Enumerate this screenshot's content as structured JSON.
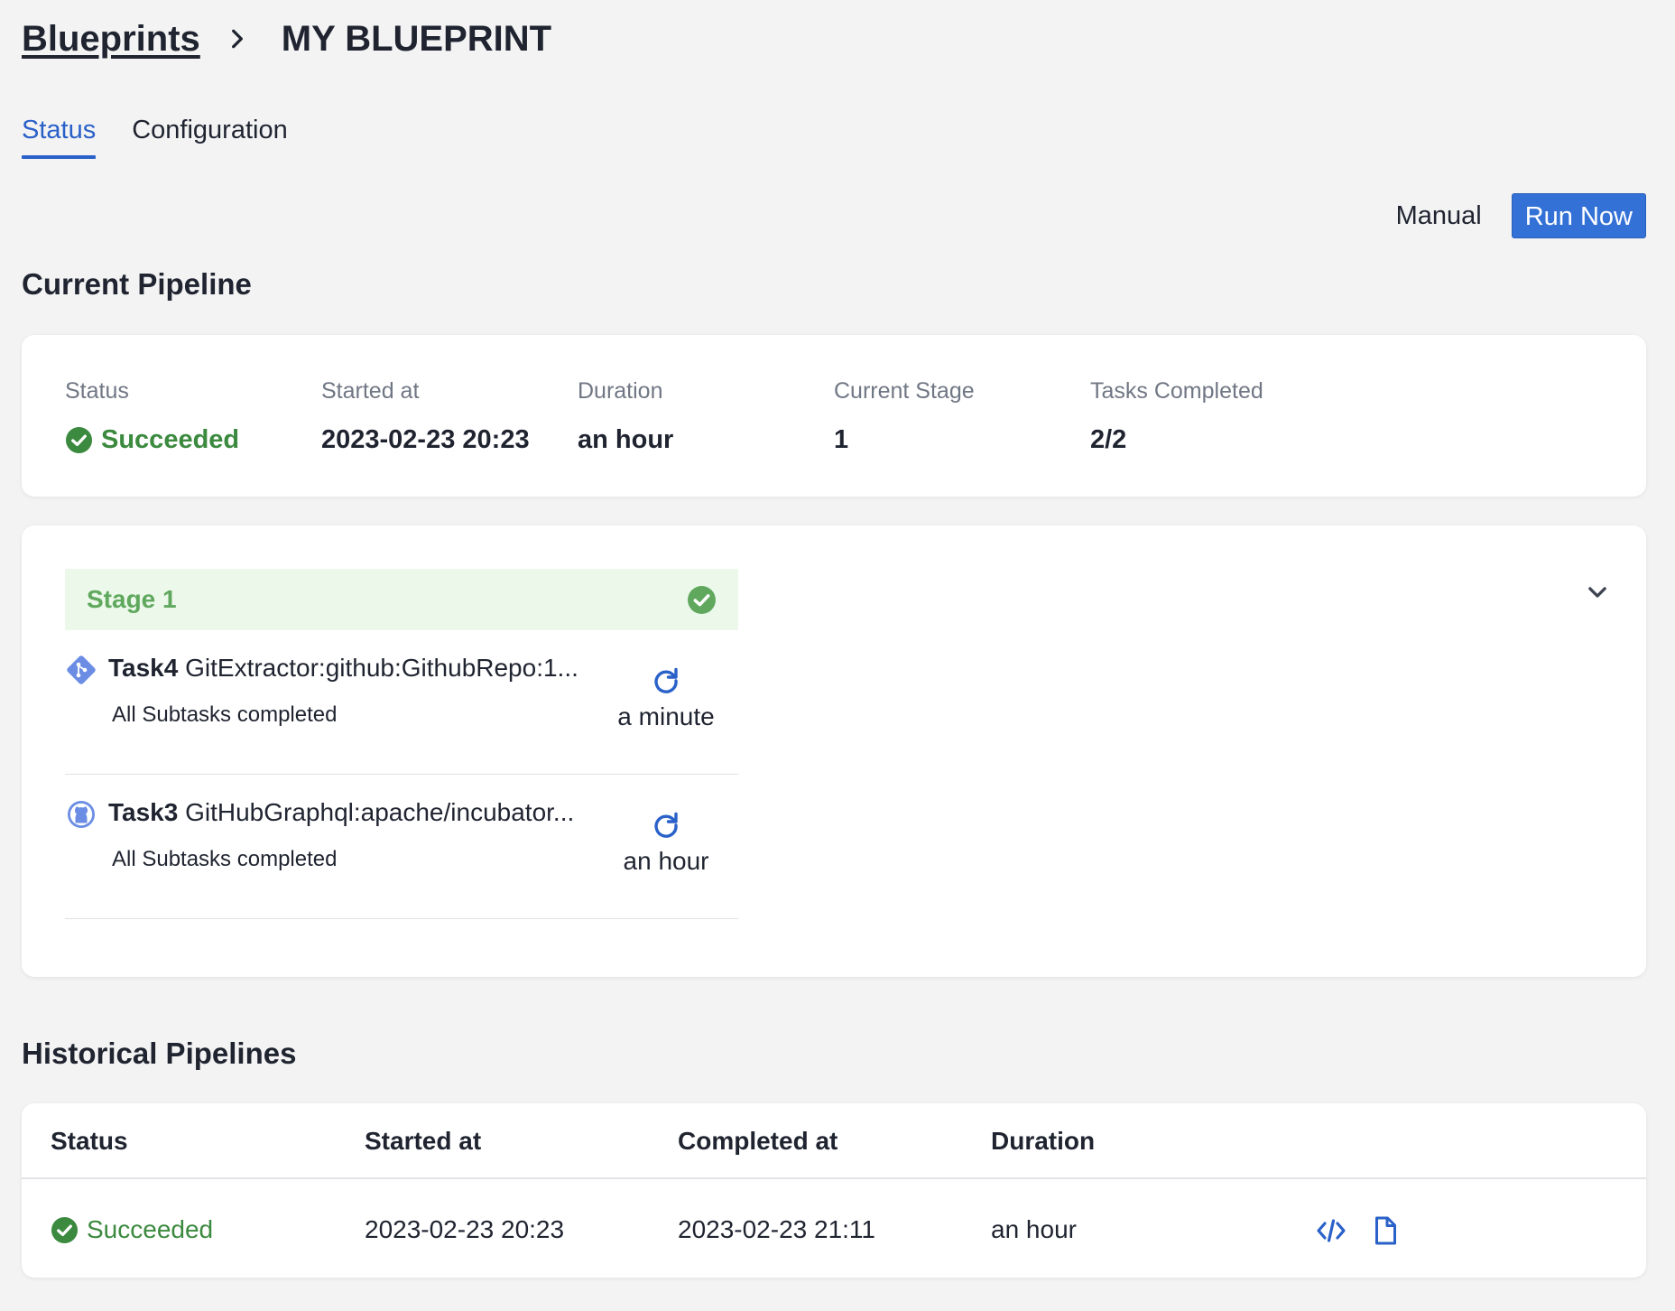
{
  "breadcrumb": {
    "root": "Blueprints",
    "current": "MY BLUEPRINT"
  },
  "tabs": [
    {
      "label": "Status",
      "active": true
    },
    {
      "label": "Configuration",
      "active": false
    }
  ],
  "actions": {
    "mode": "Manual",
    "run_label": "Run Now"
  },
  "current_pipeline": {
    "title": "Current Pipeline",
    "status_label": "Status",
    "status_value": "Succeeded",
    "started_label": "Started at",
    "started_value": "2023-02-23 20:23",
    "duration_label": "Duration",
    "duration_value": "an hour",
    "stage_label": "Current Stage",
    "stage_value": "1",
    "tasks_label": "Tasks Completed",
    "tasks_value": "2/2"
  },
  "stage": {
    "title": "Stage 1",
    "tasks": [
      {
        "id": "Task4",
        "name": "GitExtractor:github:GithubRepo:1...",
        "subtitle": "All Subtasks completed",
        "duration": "a minute",
        "icon": "git-icon"
      },
      {
        "id": "Task3",
        "name": "GitHubGraphql:apache/incubator...",
        "subtitle": "All Subtasks completed",
        "duration": "an hour",
        "icon": "github-icon"
      }
    ]
  },
  "historical": {
    "title": "Historical Pipelines",
    "columns": [
      "Status",
      "Started at",
      "Completed at",
      "Duration"
    ],
    "rows": [
      {
        "status": "Succeeded",
        "started": "2023-02-23 20:23",
        "completed": "2023-02-23 21:11",
        "duration": "an hour"
      }
    ]
  },
  "colors": {
    "accent": "#3371d6",
    "tab_active": "#2a61c9",
    "success": "#3b8a3f",
    "stage_bg": "#ebf8ea",
    "stage_text": "#5fa85d"
  }
}
